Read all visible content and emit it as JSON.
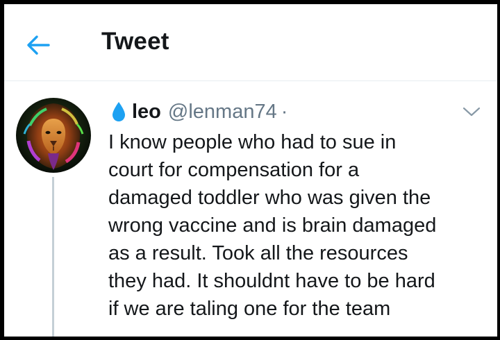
{
  "header": {
    "title": "Tweet",
    "back_icon": "arrow-left-icon"
  },
  "colors": {
    "accent": "#1da1f2",
    "text": "#14171a",
    "secondary": "#657786",
    "thread_line": "#c4cfd6"
  },
  "tweet": {
    "author": {
      "name_icon": "water-drop-icon",
      "display_name": "leo",
      "handle": "@lenman74",
      "separator": "·",
      "avatar_icon": "lion-avatar"
    },
    "menu_icon": "chevron-down-icon",
    "text_lines": [
      "I know people who had to sue in",
      "court for compensation for a",
      "damaged toddler who was given the",
      "wrong vaccine and is brain damaged",
      "as a result. Took all the resources",
      "they had. It shouldnt have to be hard",
      "if we are taling one for the team"
    ]
  }
}
